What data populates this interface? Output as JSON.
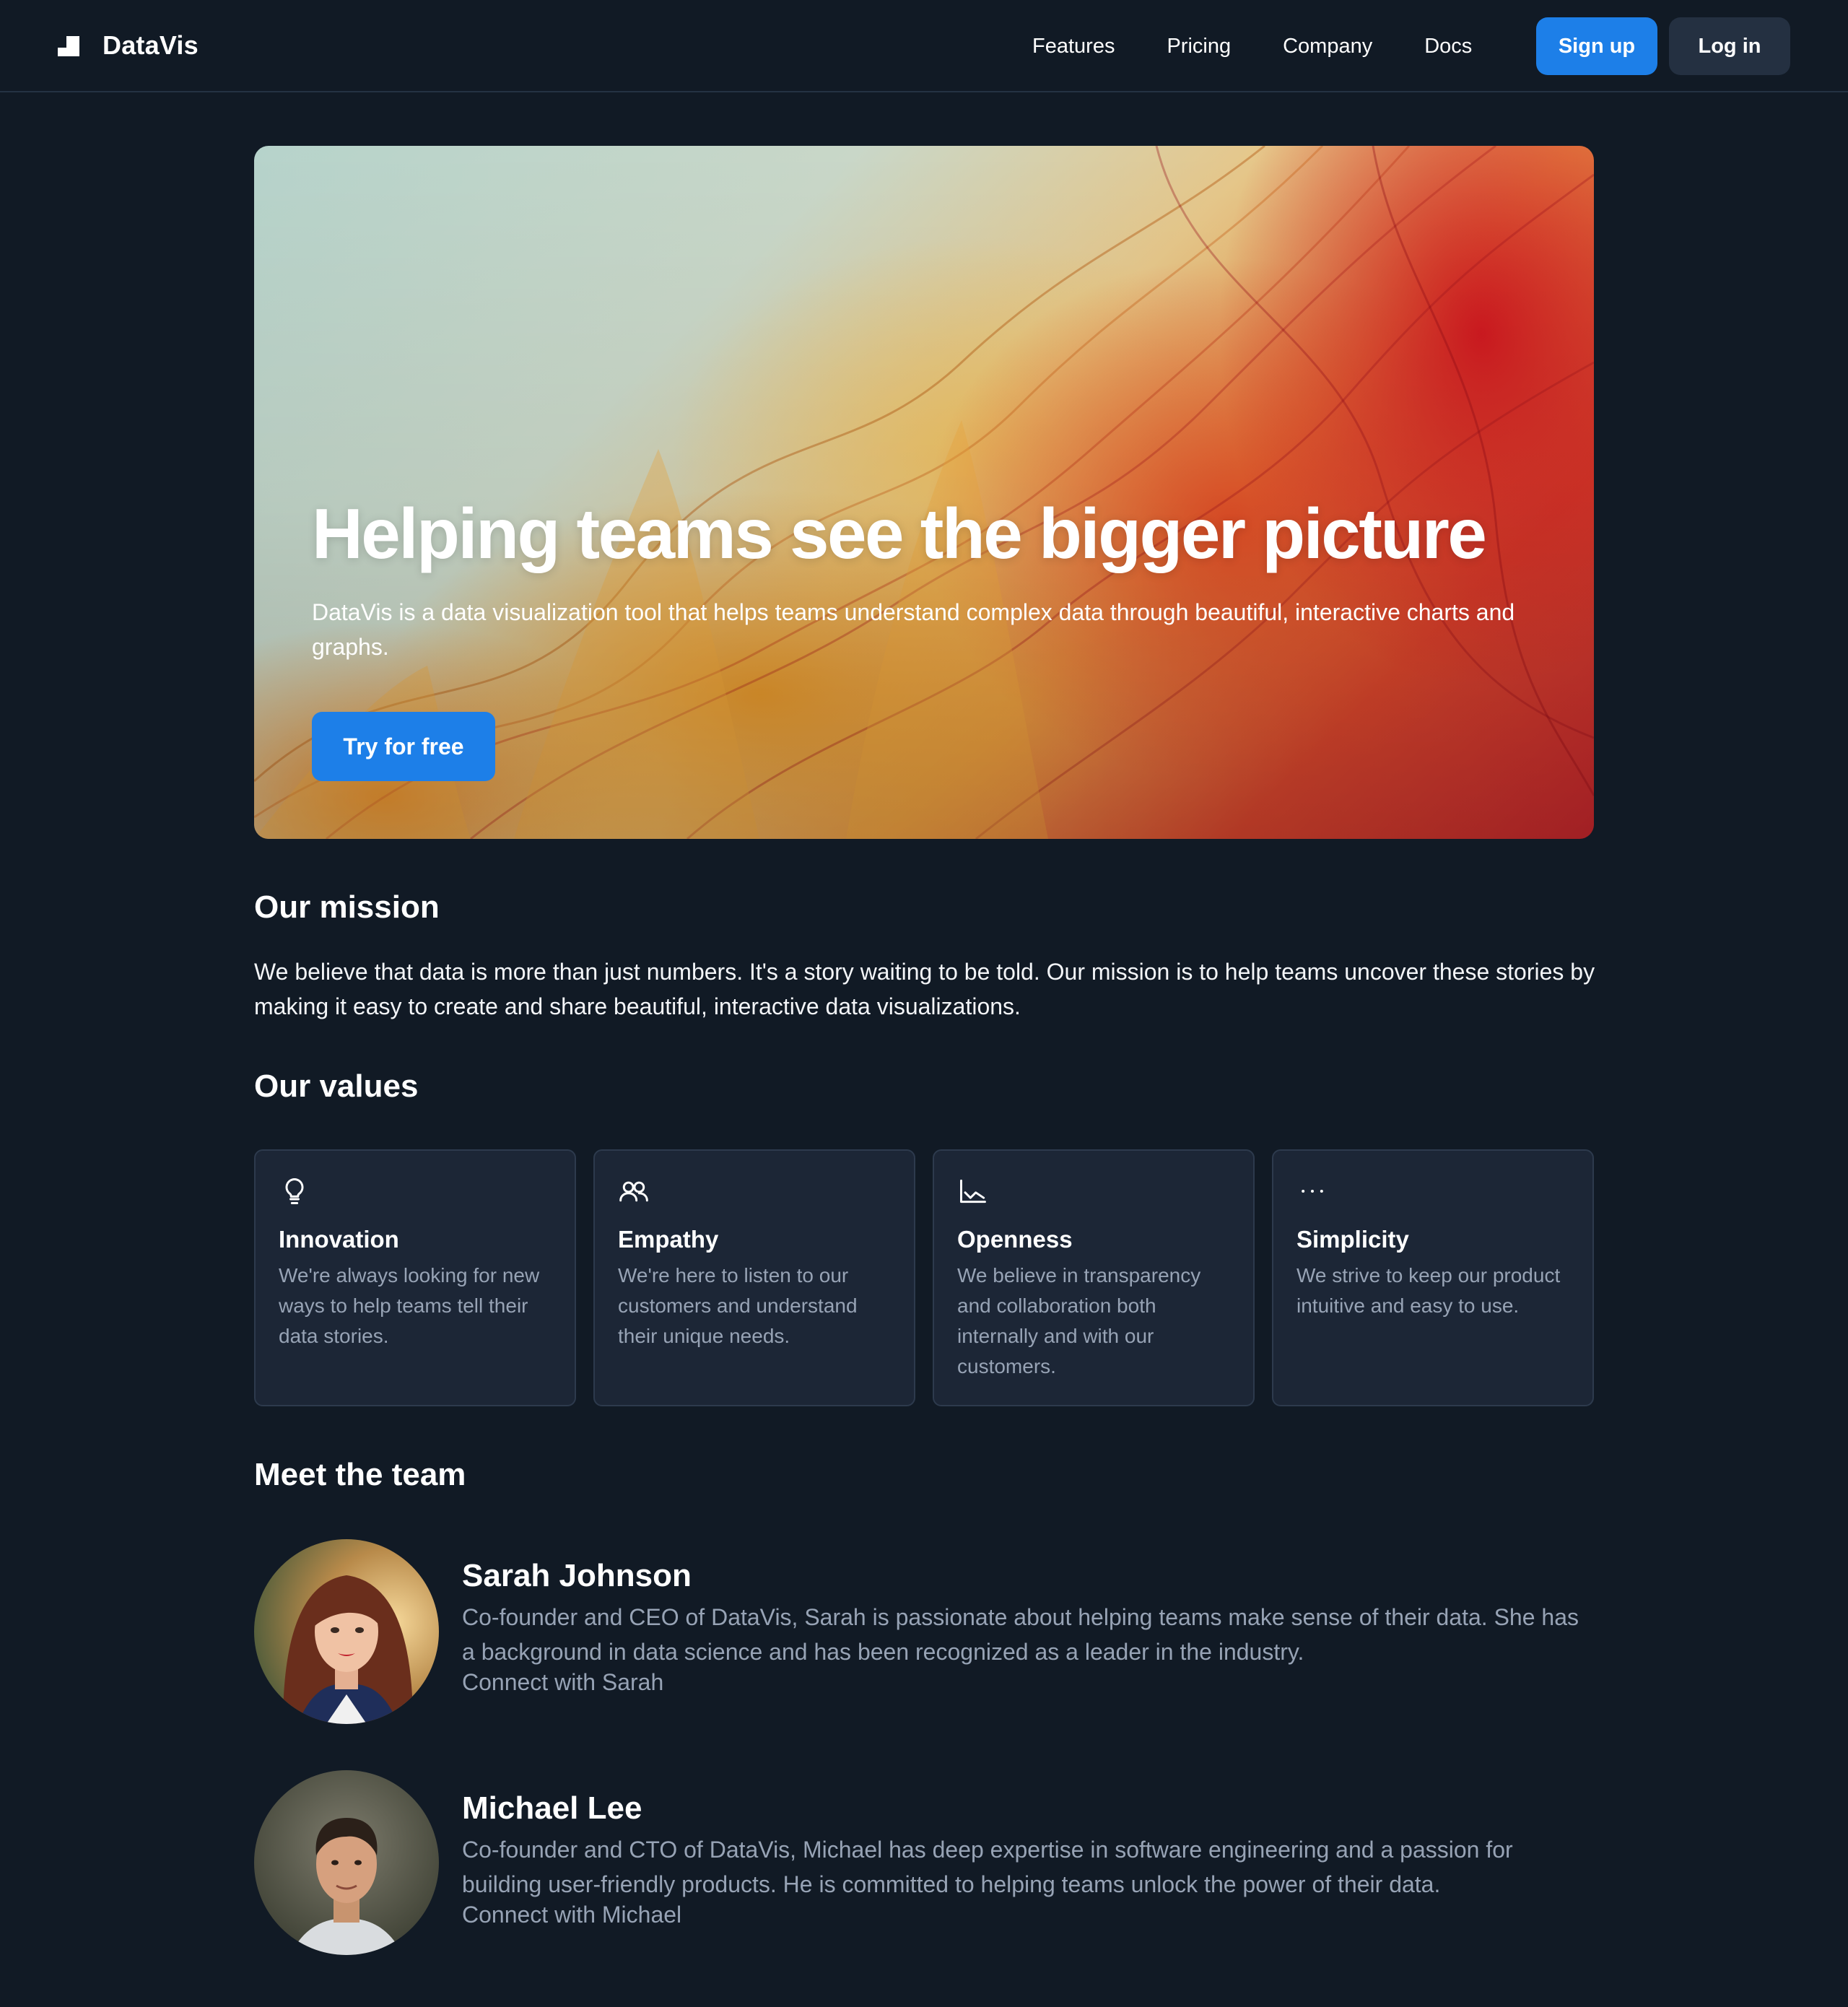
{
  "nav": {
    "brand": "DataVis",
    "links": [
      "Features",
      "Pricing",
      "Company",
      "Docs"
    ],
    "signup": "Sign up",
    "login": "Log in"
  },
  "hero": {
    "title": "Helping teams see the bigger picture",
    "subtitle": "DataVis is a data visualization tool that helps teams understand complex data through beautiful, interactive charts and graphs.",
    "cta": "Try for free"
  },
  "mission": {
    "heading": "Our mission",
    "text": "We believe that data is more than just numbers. It's a story waiting to be told. Our mission is to help teams uncover these stories by making it easy to create and share beautiful, interactive data visualizations."
  },
  "values": {
    "heading": "Our values",
    "items": [
      {
        "icon": "lightbulb-icon",
        "title": "Innovation",
        "desc": "We're always looking for new ways to help teams tell their data stories."
      },
      {
        "icon": "users-icon",
        "title": "Empathy",
        "desc": "We're here to listen to our customers and understand their unique needs."
      },
      {
        "icon": "line-chart-icon",
        "title": "Openness",
        "desc": "We believe in transparency and collaboration both internally and with our customers."
      },
      {
        "icon": "dots-icon",
        "title": "Simplicity",
        "desc": "We strive to keep our product intuitive and easy to use."
      }
    ]
  },
  "team": {
    "heading": "Meet the team",
    "members": [
      {
        "name": "Sarah Johnson",
        "bio": "Co-founder and CEO of DataVis, Sarah is passionate about helping teams make sense of their data. She has a background in data science and has been recognized as a leader in the industry.",
        "link": "Connect with Sarah"
      },
      {
        "name": "Michael Lee",
        "bio": "Co-founder and CTO of DataVis, Michael has deep expertise in software engineering and a passion for building user-friendly products. He is committed to helping teams unlock the power of their data.",
        "link": "Connect with Michael"
      }
    ]
  },
  "colors": {
    "background": "#111a25",
    "primary": "#1d7fe8",
    "card": "#1c2636",
    "muted_text": "#97a3b5"
  }
}
